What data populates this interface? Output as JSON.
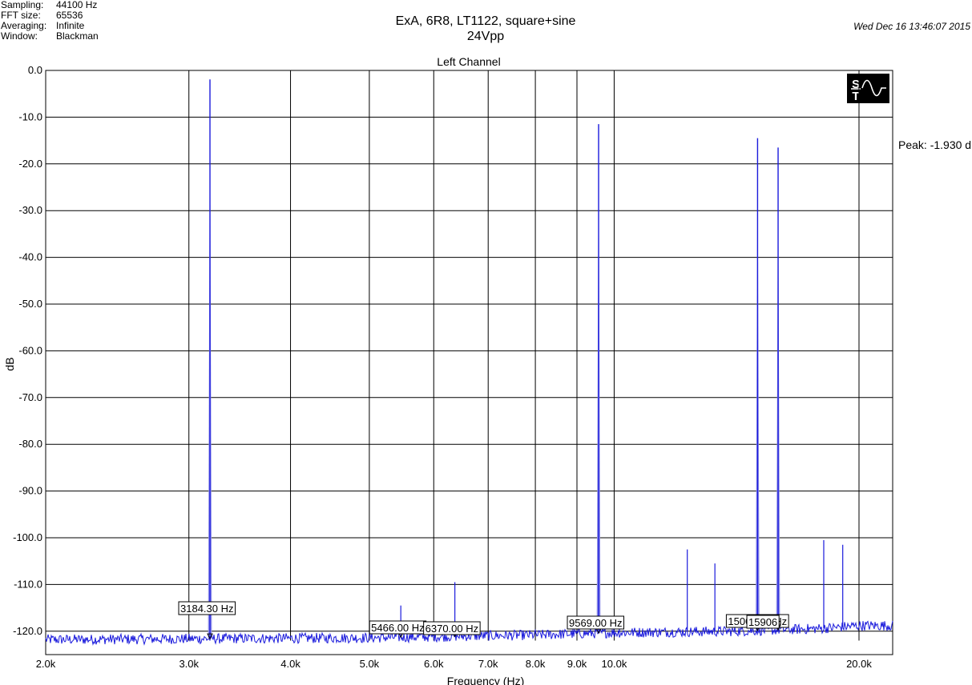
{
  "header": {
    "info": [
      {
        "label": "Sampling:",
        "value": "44100 Hz"
      },
      {
        "label": "FFT size:",
        "value": "65536"
      },
      {
        "label": "Averaging:",
        "value": "Infinite"
      },
      {
        "label": "Window:",
        "value": "Blackman"
      }
    ],
    "title_line1": "ExA, 6R8, LT1122, square+sine",
    "title_line2": "24Vpp",
    "timestamp": "Wed Dec 16 13:46:07 2015",
    "peak_readout": "Peak: -1.930 d"
  },
  "colors": {
    "trace": "#1a1adc",
    "trace_light": "#8e8ee8",
    "grid": "#000000",
    "background": "#ffffff"
  },
  "chart_data": {
    "type": "line",
    "title": "Left Channel",
    "xlabel": "Frequency (Hz)",
    "ylabel": "dB",
    "x_scale": "log",
    "xlim": [
      2000,
      22000
    ],
    "ylim": [
      -122,
      0
    ],
    "grid": true,
    "x_ticks": [
      {
        "value": 2000,
        "label": "2.0k"
      },
      {
        "value": 3000,
        "label": "3.0k"
      },
      {
        "value": 4000,
        "label": "4.0k"
      },
      {
        "value": 5000,
        "label": "5.0k"
      },
      {
        "value": 6000,
        "label": "6.0k"
      },
      {
        "value": 7000,
        "label": "7.0k"
      },
      {
        "value": 8000,
        "label": "8.0k"
      },
      {
        "value": 9000,
        "label": "9.0k"
      },
      {
        "value": 10000,
        "label": "10.0k"
      },
      {
        "value": 20000,
        "label": "20.0k"
      }
    ],
    "y_ticks": [
      {
        "value": 0,
        "label": "0.0"
      },
      {
        "value": -10,
        "label": "-10.0"
      },
      {
        "value": -20,
        "label": "-20.0"
      },
      {
        "value": -30,
        "label": "-30.0"
      },
      {
        "value": -40,
        "label": "-40.0"
      },
      {
        "value": -50,
        "label": "-50.0"
      },
      {
        "value": -60,
        "label": "-60.0"
      },
      {
        "value": -70,
        "label": "-70.0"
      },
      {
        "value": -80,
        "label": "-80.0"
      },
      {
        "value": -90,
        "label": "-90.0"
      },
      {
        "value": -100,
        "label": "-100.0"
      },
      {
        "value": -110,
        "label": "-110.0"
      },
      {
        "value": -120,
        "label": "-120.0"
      }
    ],
    "noise_floor": [
      {
        "x": 2000,
        "y": -121.8
      },
      {
        "x": 5000,
        "y": -121.4
      },
      {
        "x": 8000,
        "y": -120.8
      },
      {
        "x": 10000,
        "y": -120.3
      },
      {
        "x": 14000,
        "y": -120.0
      },
      {
        "x": 16000,
        "y": -119.7
      },
      {
        "x": 18000,
        "y": -119.4
      },
      {
        "x": 20000,
        "y": -118.8
      },
      {
        "x": 22000,
        "y": -118.8
      }
    ],
    "peaks": [
      {
        "x": 3184.3,
        "y": -1.93
      },
      {
        "x": 5466,
        "y": -114.5
      },
      {
        "x": 6370,
        "y": -109.5
      },
      {
        "x": 9569,
        "y": -11.5
      },
      {
        "x": 10150,
        "y": -118.0
      },
      {
        "x": 12300,
        "y": -102.5
      },
      {
        "x": 13300,
        "y": -105.5
      },
      {
        "x": 15008,
        "y": -14.5
      },
      {
        "x": 15906,
        "y": -16.5
      },
      {
        "x": 18100,
        "y": -100.5
      },
      {
        "x": 19100,
        "y": -101.5
      }
    ],
    "markers": [
      {
        "x": 3184.3,
        "label": "3184.30 Hz"
      },
      {
        "x": 5466,
        "label": "5466.00 Hz"
      },
      {
        "x": 6370,
        "label": "6370.00 Hz"
      },
      {
        "x": 9569,
        "label": "9569.00 Hz"
      },
      {
        "x": 15008,
        "label": "15008.00 Hz"
      },
      {
        "x": 15906,
        "label": "15906"
      }
    ]
  }
}
